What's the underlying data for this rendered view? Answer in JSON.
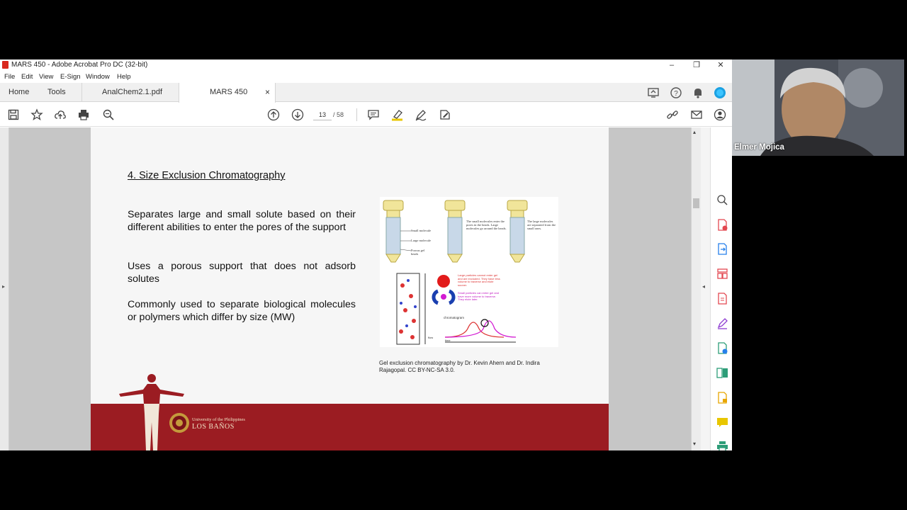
{
  "window": {
    "title": "MARS 450 - Adobe Acrobat Pro DC (32-bit)",
    "controls": {
      "minimize": "–",
      "restore": "❐",
      "close": "✕"
    }
  },
  "menu": [
    "File",
    "Edit",
    "View",
    "E-Sign",
    "Window",
    "Help"
  ],
  "tabs": {
    "home": "Home",
    "tools": "Tools",
    "doc1": "AnalChem2.1.pdf",
    "doc2": "MARS 450",
    "close": "×"
  },
  "toolbar": {
    "current_page": "13",
    "total_pages": "/ 58"
  },
  "slide": {
    "title": "4. Size Exclusion Chromatography",
    "bullets": [
      "Separates large and small solute based on their different abilities to enter the pores of the support",
      "Uses a porous support that does not adsorb solutes",
      "Commonly used to separate biological molecules or polymers which differ by size (MW)"
    ],
    "figure": {
      "label_small": "Small molecule",
      "label_large": "Large molecule",
      "label_beads": "Porous gel beads",
      "note_mid": "The small molecules enter the pores in the beads. Large molecules go around the beads.",
      "note_right": "The large molecules are separated from the small ones.",
      "note_red": "Large particles cannot enter gel and are excluded. They have less volume to traverse and elute sooner.",
      "note_pink": "Small particles can enter gel and have more volume to traverse. They elute later.",
      "chromatogram": "chromatogram",
      "time": "time",
      "flow": "flow"
    },
    "caption": "Gel exclusion chromatography by Dr. Kevin Ahern and Dr. Indira Rajagopal.  CC BY-NC-SA 3.0.",
    "footer_line1": "University of the Philippines",
    "footer_line2": "LOS BAÑOS"
  },
  "participant": {
    "name": "Elmer Mojica"
  },
  "colors": {
    "band": "#9b1c22",
    "accent": "#1473e6",
    "tool_red": "#e34850",
    "tool_blue": "#2680eb",
    "tool_green": "#2d9d78",
    "tool_yellow": "#e8c600"
  }
}
